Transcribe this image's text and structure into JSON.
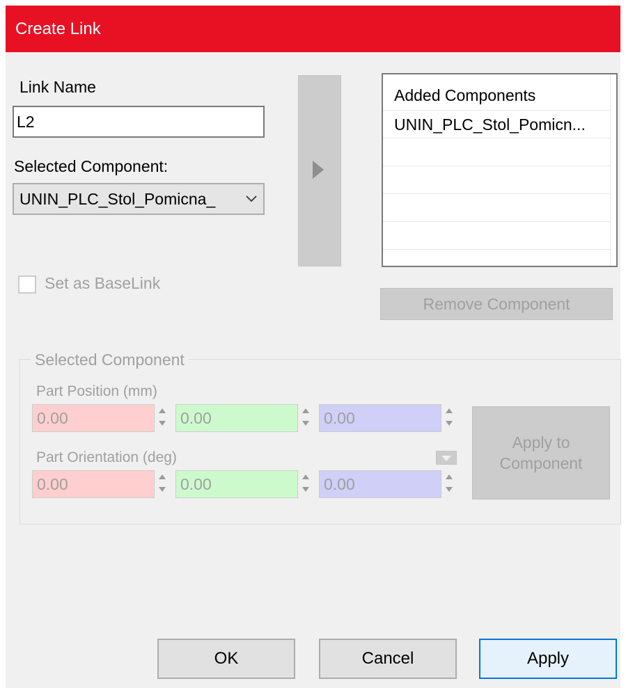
{
  "window": {
    "title": "Create Link"
  },
  "link_name": {
    "label": "Link Name",
    "value": "L2"
  },
  "selected_component": {
    "label": "Selected Component:",
    "value": "UNIN_PLC_Stol_Pomicna_"
  },
  "added_components": {
    "header": "Added Components",
    "items": [
      "UNIN_PLC_Stol_Pomicn..."
    ]
  },
  "base_link": {
    "label": "Set as BaseLink",
    "checked": false
  },
  "remove_button": {
    "label": "Remove Component"
  },
  "component_group": {
    "title": "Selected Component",
    "position_label": "Part Position (mm)",
    "position": {
      "x": "0.00",
      "y": "0.00",
      "z": "0.00"
    },
    "orientation_label": "Part Orientation (deg)",
    "orientation": {
      "x": "0.00",
      "y": "0.00",
      "z": "0.00"
    },
    "apply_button_line1": "Apply to",
    "apply_button_line2": "Component"
  },
  "buttons": {
    "ok": "OK",
    "cancel": "Cancel",
    "apply": "Apply"
  },
  "colors": {
    "titlebar": "#e81123",
    "x_axis": "#ffcfcf",
    "y_axis": "#cdfacd",
    "z_axis": "#cfcff7",
    "default_button_border": "#0078d7"
  },
  "icons": {
    "add": "triangle-right-icon",
    "dropdown": "chevron-down-icon",
    "spinner": "up-down-arrows-icon"
  }
}
